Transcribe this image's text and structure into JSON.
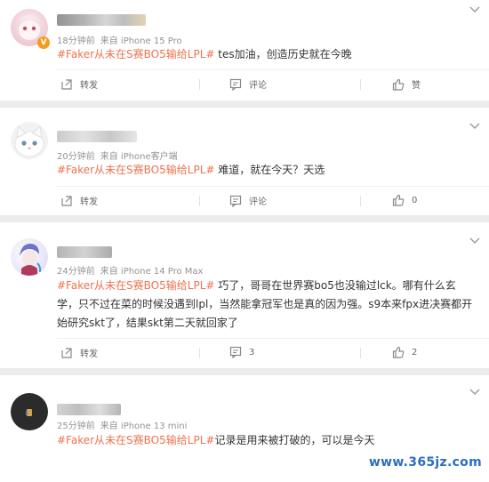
{
  "comments": [
    {
      "time": "18分钟前",
      "source": "来自 iPhone 15 Pro",
      "hashtag": "#Faker从未在S赛BO5输给LPL#",
      "body": " tes加油，创造历史就在今晚",
      "repost": "转发",
      "comment": "评论",
      "like": "赞"
    },
    {
      "time": "20分钟前",
      "source": "来自 iPhone客户端",
      "hashtag": "#Faker从未在S赛BO5输给LPL#",
      "body": " 难道，就在今天？天选",
      "comment_count": "评论",
      "like_count": "0"
    },
    {
      "time": "24分钟前",
      "source": "来自 iPhone 14 Pro Max",
      "hashtag": "#Faker从未在S赛BO5输给LPL#",
      "body": " 巧了，哥哥在世界赛bo5也没输过lck。哪有什么玄学，只不过在菜的时候没遇到lpl，当然能拿冠军也是真的因为强。s9本来fpx进决赛都开始研究skt了，结果skt第二天就回家了",
      "repost": "转发",
      "comment_count": "3",
      "like_count": "2"
    },
    {
      "time": "25分钟前",
      "source": "来自 iPhone 13 mini",
      "hashtag": "#Faker从未在S赛BO5输给LPL#",
      "body": "记录是用来被打破的，可以是今天"
    }
  ],
  "verified_badge": "V",
  "watermark": "www.365jz.com",
  "colors": {
    "hashtag": "#eb7350",
    "meta": "#939393",
    "badge": "#f39b22"
  },
  "icons": [
    "chevron-down-icon",
    "repost-icon",
    "comment-icon",
    "like-icon"
  ]
}
